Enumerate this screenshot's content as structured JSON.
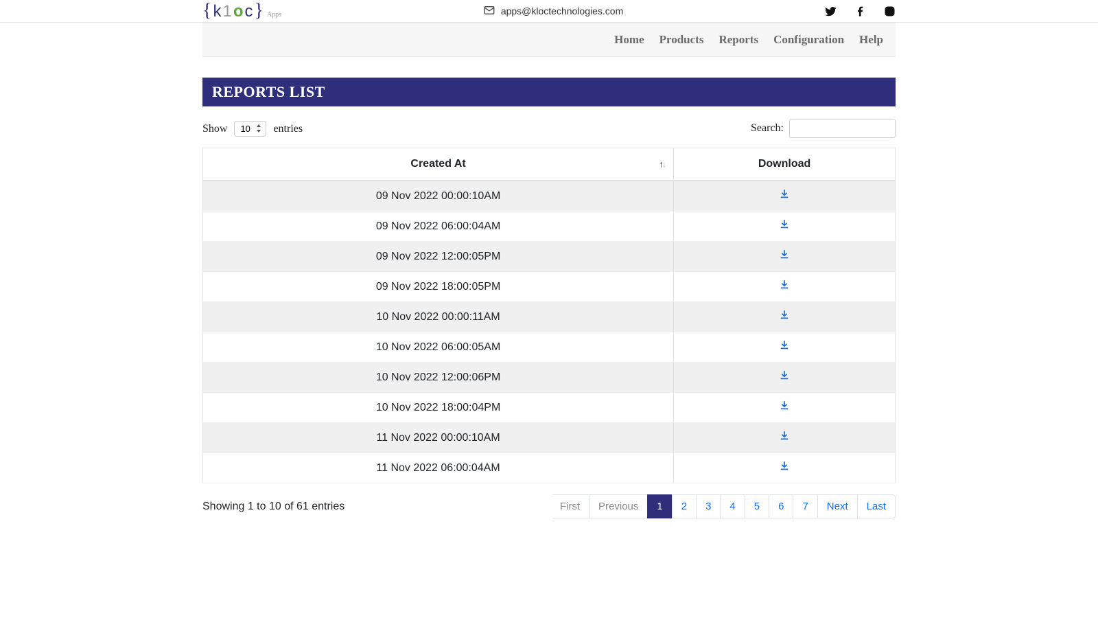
{
  "header": {
    "email": "apps@kloctechnologies.com",
    "logo_apps_suffix": "Apps"
  },
  "nav": {
    "items": [
      "Home",
      "Products",
      "Reports",
      "Configuration",
      "Help"
    ]
  },
  "page_title": "REPORTS LIST",
  "table_controls": {
    "show_prefix": "Show",
    "show_suffix": "entries",
    "page_size": "10",
    "search_label": "Search:"
  },
  "columns": {
    "created_at": "Created At",
    "download": "Download"
  },
  "rows": [
    {
      "created_at": "09 Nov 2022 00:00:10AM"
    },
    {
      "created_at": "09 Nov 2022 06:00:04AM"
    },
    {
      "created_at": "09 Nov 2022 12:00:05PM"
    },
    {
      "created_at": "09 Nov 2022 18:00:05PM"
    },
    {
      "created_at": "10 Nov 2022 00:00:11AM"
    },
    {
      "created_at": "10 Nov 2022 06:00:05AM"
    },
    {
      "created_at": "10 Nov 2022 12:00:06PM"
    },
    {
      "created_at": "10 Nov 2022 18:00:04PM"
    },
    {
      "created_at": "11 Nov 2022 00:00:10AM"
    },
    {
      "created_at": "11 Nov 2022 06:00:04AM"
    }
  ],
  "info_text": "Showing 1 to 10 of 61 entries",
  "pagination": {
    "first": "First",
    "previous": "Previous",
    "pages": [
      "1",
      "2",
      "3",
      "4",
      "5",
      "6",
      "7"
    ],
    "active_page": "1",
    "next": "Next",
    "last": "Last"
  }
}
